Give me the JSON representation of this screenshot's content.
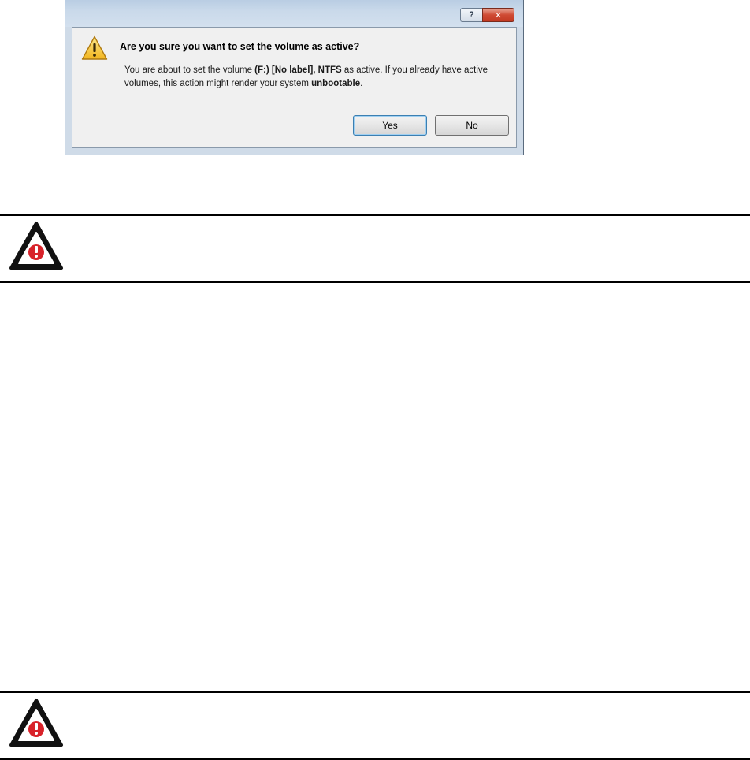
{
  "dialog": {
    "title_buttons": {
      "help_label": "?",
      "close_label": "✕"
    },
    "heading": "Are you sure you want to set the volume as active?",
    "message": {
      "part1": "You are about to set the volume ",
      "volume": "(F:) [No label], NTFS",
      "part2": " as active. If you already have active volumes, this action might render your system ",
      "unbootable": "unbootable",
      "part3": "."
    },
    "buttons": {
      "yes": "Yes",
      "no": "No"
    },
    "icon": "warning-triangle-icon"
  },
  "notes": [
    {
      "icon": "alert-triangle-icon",
      "text": ""
    },
    {
      "icon": "alert-triangle-icon",
      "text": ""
    }
  ],
  "colors": {
    "dialog_frame": "#cfdbe8",
    "close_button": "#c23a22",
    "warning_yellow": "#f2c12e",
    "alert_red": "#d8222a"
  }
}
